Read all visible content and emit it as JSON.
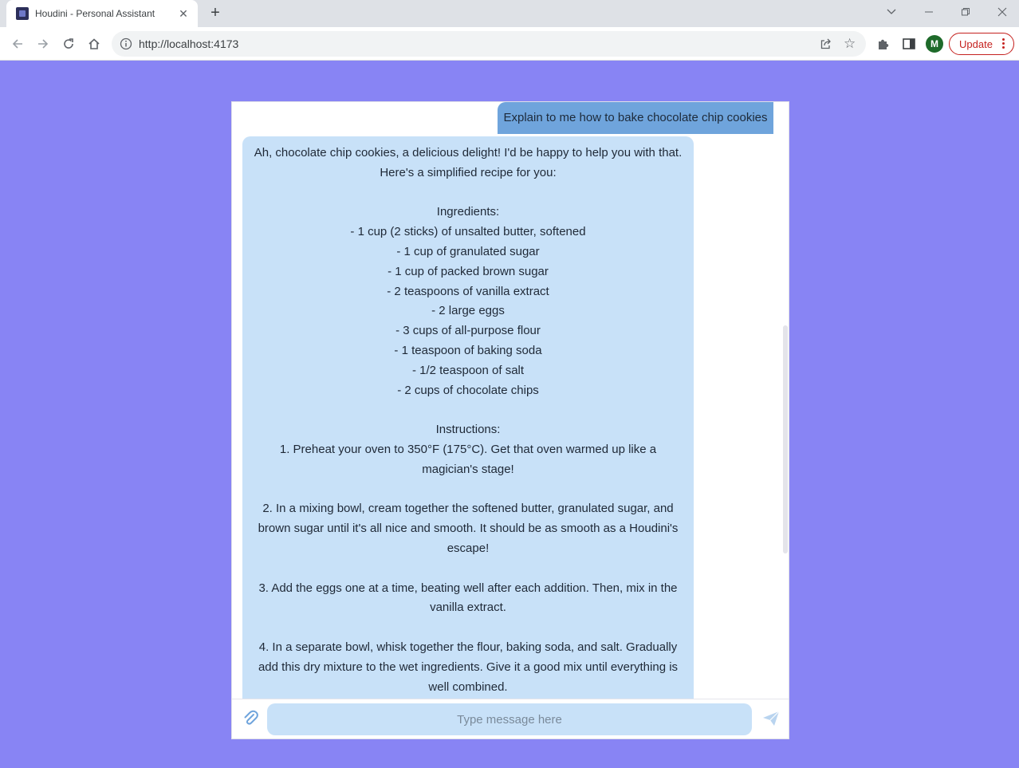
{
  "browser": {
    "tab_title": "Houdini - Personal Assistant",
    "url": "http://localhost:4173",
    "profile_initial": "M",
    "update_label": "Update"
  },
  "chat": {
    "user_message": "Explain to me how to bake chocolate chip cookies",
    "bot_message": "Ah, chocolate chip cookies, a delicious delight! I'd be happy to help you with that. Here's a simplified recipe for you:\n\nIngredients:\n- 1 cup (2 sticks) of unsalted butter, softened\n- 1 cup of granulated sugar\n- 1 cup of packed brown sugar\n- 2 teaspoons of vanilla extract\n- 2 large eggs\n- 3 cups of all-purpose flour\n- 1 teaspoon of baking soda\n- 1/2 teaspoon of salt\n- 2 cups of chocolate chips\n\nInstructions:\n1. Preheat your oven to 350°F (175°C). Get that oven warmed up like a magician's stage!\n\n2. In a mixing bowl, cream together the softened butter, granulated sugar, and brown sugar until it's all nice and smooth. It should be as smooth as a Houdini's escape!\n\n3. Add the eggs one at a time, beating well after each addition. Then, mix in the vanilla extract.\n\n4. In a separate bowl, whisk together the flour, baking soda, and salt. Gradually add this dry mixture to the wet ingredients. Give it a good mix until everything is well combined.",
    "input_placeholder": "Type message here"
  },
  "colors": {
    "page_background": "#8884f4",
    "user_bubble": "#6fa4dc",
    "bot_bubble": "#c8e1f8",
    "update_accent": "#c5221f"
  },
  "icons": {
    "attach": "paperclip-icon",
    "send": "send-icon"
  }
}
